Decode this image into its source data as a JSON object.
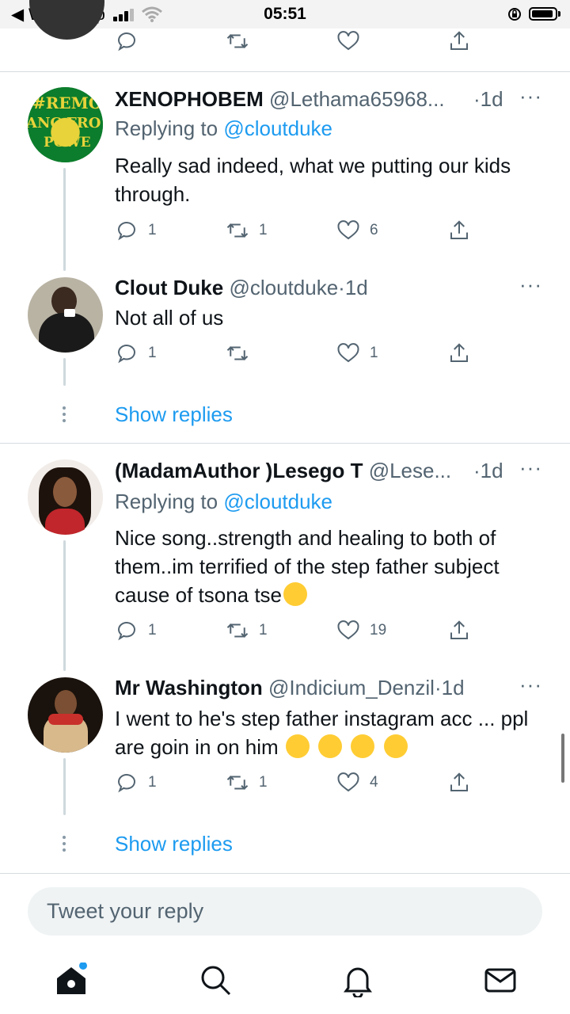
{
  "status_bar": {
    "back_app": "◀ WhatsApp",
    "time": "05:51"
  },
  "tweets": [
    {
      "name": "XENOPHOBEM",
      "handle": "@Lethama65968...",
      "age": "·1d",
      "replying_prefix": "Replying to",
      "replying_handle": "@cloutduke",
      "text": "Really sad indeed, what we putting our kids through.",
      "replies": "1",
      "retweets": "1",
      "likes": "6"
    },
    {
      "name": "Clout Duke",
      "handle": "@cloutduke",
      "age": "·1d",
      "text": "Not all of us",
      "replies": "1",
      "retweets": "",
      "likes": "1",
      "show_replies": "Show replies"
    },
    {
      "name": "(MadamAuthor )Lesego T",
      "handle": "@Lese...",
      "age": "·1d",
      "replying_prefix": "Replying to",
      "replying_handle": "@cloutduke",
      "text": "Nice song..strength and healing to both of them..im terrified of the step father subject cause of tsona tse",
      "replies": "1",
      "retweets": "1",
      "likes": "19"
    },
    {
      "name": "Mr Washington",
      "handle": "@Indicium_Denzil",
      "age": "·1d",
      "text": "I went to he's step father instagram acc ... ppl are goin in on him",
      "replies": "1",
      "retweets": "1",
      "likes": "4",
      "show_replies": "Show replies"
    }
  ],
  "avatar_texts": {
    "xeno_line1": "#REMO",
    "xeno_line2": "ANC FRO",
    "xeno_line3": "POWE"
  },
  "reply_box": {
    "placeholder": "Tweet your reply"
  },
  "more_label": "···",
  "colors": {
    "accent": "#1d9bf0",
    "muted": "#536471",
    "notification_dot": "#1d9bf0"
  },
  "icons": [
    "home-icon",
    "search-icon",
    "bell-icon",
    "mail-icon",
    "reply-icon",
    "retweet-icon",
    "like-icon",
    "share-icon"
  ]
}
